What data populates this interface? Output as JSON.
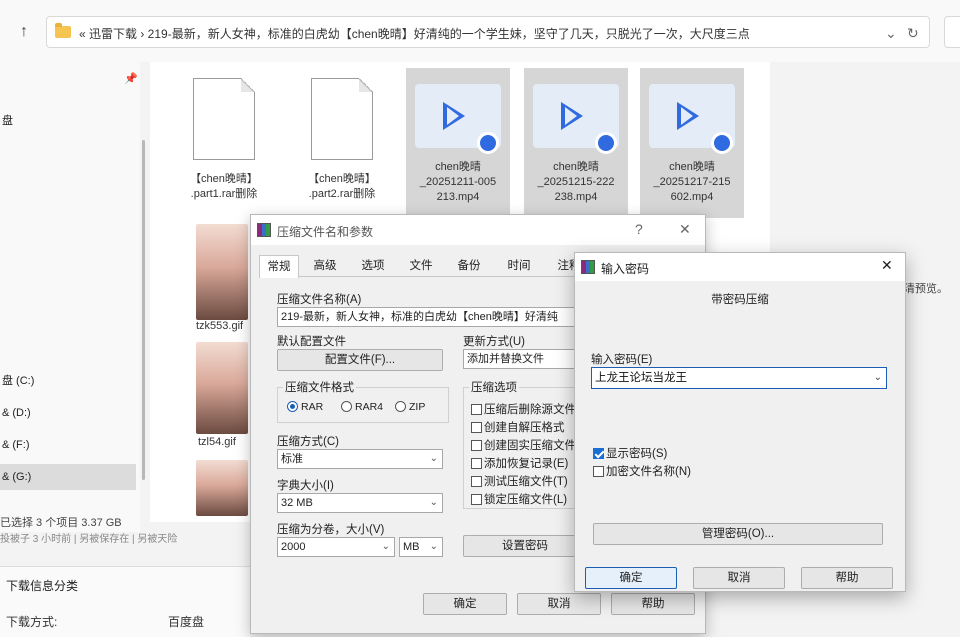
{
  "explorer": {
    "breadcrumb": "«  迅雷下载  ›  219-最新，新人女神，标准的白虎幼【chen晚晴】好清纯的一个学生妹，坚守了几天，只脱光了一次，大尺度三点",
    "refresh_icon": "refresh-icon",
    "sidebar_items": [
      "盘 (C:)",
      "& (D:)",
      "& (F:)",
      "& (G:)"
    ],
    "sidebar_top_label": "盘",
    "files": [
      {
        "name": "【chen晚晴】\n.part1.rar删除",
        "type": "doc"
      },
      {
        "name": "【chen晚晴】\n.part2.rar删除",
        "type": "doc"
      },
      {
        "name": "chen晚晴\n_20251211-005\n213.mp4",
        "type": "video"
      },
      {
        "name": "chen晚晴\n_20251215-222\n238.mp4",
        "type": "video"
      },
      {
        "name": "chen晚晴\n_20251217-215\n602.mp4",
        "type": "video"
      }
    ],
    "thumbs": [
      "tzk553.gif",
      "tzl54.gif"
    ],
    "status": "已选择 3 个项目  3.37 GB",
    "status2": "投被子 3 小时前  |  另被保存在  |  另被天险",
    "bottom_panel": {
      "title": "下载信息分类",
      "label": "下载方式:",
      "value": "百度盘"
    },
    "right_note": "清预览。"
  },
  "archive_dialog": {
    "title": "压缩文件名和参数",
    "help_glyph": "?",
    "close_glyph": "✕",
    "tabs": [
      "常规",
      "高级",
      "选项",
      "文件",
      "备份",
      "时间",
      "注释"
    ],
    "archive_name_label": "压缩文件名称(A)",
    "archive_name_value": "219-最新，新人女神，标准的白虎幼【chen晚晴】好清纯",
    "profile_label": "默认配置文件",
    "profile_button": "配置文件(F)...",
    "update_label": "更新方式(U)",
    "update_value": "添加并替换文件",
    "format_group": "压缩文件格式",
    "formats": [
      "RAR",
      "RAR4",
      "ZIP"
    ],
    "options_group": "压缩选项",
    "options": [
      "压缩后删除源文件",
      "创建自解压格式",
      "创建固实压缩文件",
      "添加恢复记录(E)",
      "测试压缩文件(T)",
      "锁定压缩文件(L)"
    ],
    "method_label": "压缩方式(C)",
    "method_value": "标准",
    "dict_label": "字典大小(I)",
    "dict_value": "32 MB",
    "split_label": "压缩为分卷，大小(V)",
    "split_value": "2000",
    "split_unit": "MB",
    "set_password_button": "设置密码",
    "ok": "确定",
    "cancel": "取消",
    "help": "帮助"
  },
  "password_dialog": {
    "title": "输入密码",
    "close_glyph": "✕",
    "heading": "带密码压缩",
    "input_label": "输入密码(E)",
    "input_value": "上龙王论坛当龙王",
    "show_password": "显示密码(S)",
    "encrypt_names": "加密文件名称(N)",
    "manage_button": "管理密码(O)...",
    "ok": "确定",
    "cancel": "取消",
    "help": "帮助"
  }
}
